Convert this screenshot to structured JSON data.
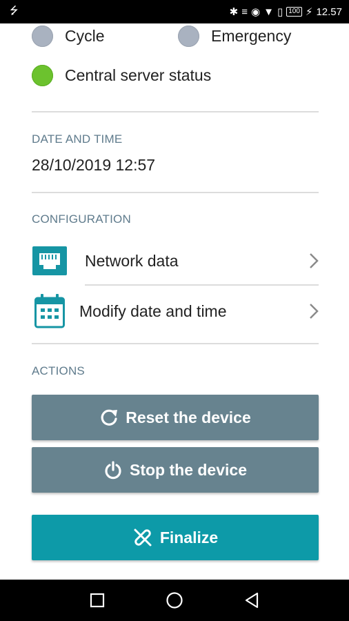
{
  "status_bar": {
    "time": "12.57",
    "battery": "100",
    "icons": [
      "usb-icon",
      "bluetooth-icon",
      "vibrate-icon",
      "eye-icon",
      "wifi-icon",
      "sim-icon",
      "battery-icon"
    ]
  },
  "status_indicators": [
    {
      "label": "Cycle",
      "color": "#a9b2c0"
    },
    {
      "label": "Emergency",
      "color": "#a9b2c0"
    },
    {
      "label": "Central server status",
      "color": "#6cc22e"
    }
  ],
  "date_time": {
    "header": "DATE AND TIME",
    "value": "28/10/2019 12:57"
  },
  "configuration": {
    "header": "CONFIGURATION",
    "items": [
      {
        "label": "Network data",
        "icon": "ethernet-icon"
      },
      {
        "label": "Modify date and time",
        "icon": "calendar-icon"
      }
    ]
  },
  "actions": {
    "header": "ACTIONS",
    "reset_label": "Reset the device",
    "stop_label": "Stop the device",
    "finalize_label": "Finalize"
  },
  "colors": {
    "accent_teal": "#0d9aa8",
    "action_grey": "#67838f",
    "section_header": "#5f7b8c",
    "status_inactive": "#a9b2c0",
    "status_active": "#6cc22e"
  }
}
